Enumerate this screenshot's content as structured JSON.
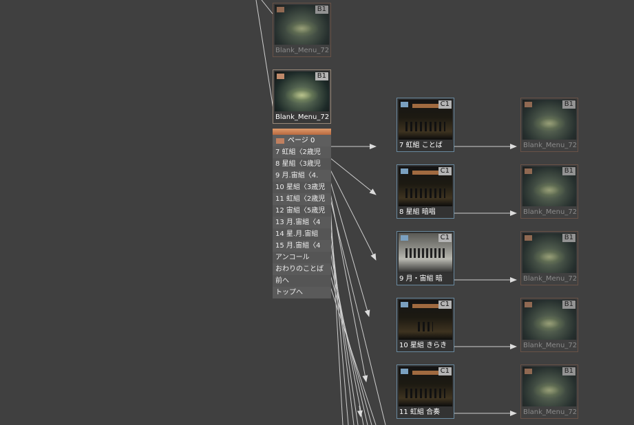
{
  "menu_nodes": [
    {
      "label": "Blank_Menu_72",
      "badge": "B1"
    },
    {
      "label": "Blank_Menu_72",
      "badge": "B1"
    }
  ],
  "button_list": {
    "page_label": "ページ 0",
    "items": [
      "7 虹組〈2歳児",
      "8 星組〈3歳児",
      "9 月.宙組〈4.",
      "10 星組〈3歳児",
      "11 虹組〈2歳児",
      "12 宙組〈5歳児",
      "13 月.宙組〈4",
      "14 星.月.宙組",
      "15 月.宙組〈4",
      "アンコール",
      "おわりのことば",
      "前へ",
      "トップへ"
    ]
  },
  "title_nodes": [
    {
      "label": "7 虹組 ことば",
      "badge": "C1"
    },
    {
      "label": "8 星組 暗唱",
      "badge": "C1"
    },
    {
      "label": "9 月・宙組 暗",
      "badge": "C1"
    },
    {
      "label": "10 星組 きらき",
      "badge": "C1"
    },
    {
      "label": "11 虹組 合奏",
      "badge": "C1"
    }
  ],
  "right_menu_nodes": [
    {
      "label": "Blank_Menu_72",
      "badge": "B1"
    },
    {
      "label": "Blank_Menu_72",
      "badge": "B1"
    },
    {
      "label": "Blank_Menu_72",
      "badge": "B1"
    },
    {
      "label": "Blank_Menu_72",
      "badge": "B1"
    },
    {
      "label": "Blank_Menu_72",
      "badge": "B1"
    }
  ]
}
